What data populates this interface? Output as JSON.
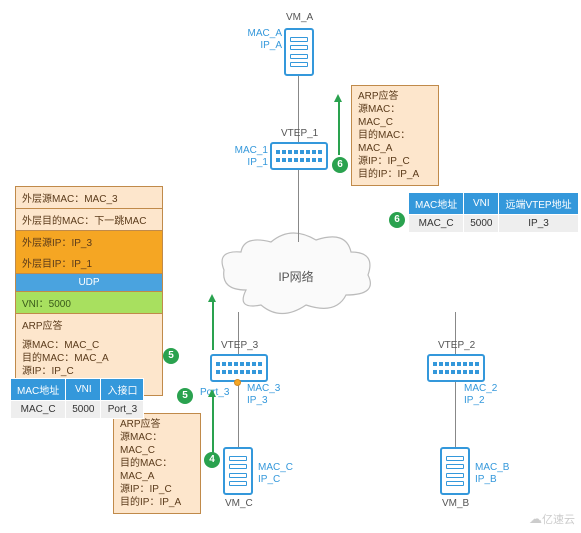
{
  "vm_a": {
    "mac": "MAC_A",
    "ip": "IP_A",
    "label": "VM_A"
  },
  "vm_b": {
    "mac": "MAC_B",
    "ip": "IP_B",
    "label": "VM_B"
  },
  "vm_c": {
    "mac": "MAC_C",
    "ip": "IP_C",
    "label": "VM_C"
  },
  "vtep1": {
    "name": "VTEP_1",
    "mac": "MAC_1",
    "ip": "IP_1"
  },
  "vtep2": {
    "name": "VTEP_2",
    "mac": "MAC_2",
    "ip": "IP_2"
  },
  "vtep3": {
    "name": "VTEP_3",
    "mac": "MAC_3",
    "ip": "IP_3",
    "port": "Port_3"
  },
  "cloud_label": "IP网络",
  "step4": "4",
  "step5a": "5",
  "step5b": "5",
  "step6a": "6",
  "step6b": "6",
  "packet_outer": {
    "l2_src": "外层源MAC：MAC_3",
    "l2_dst": "外层目的MAC：下一跳MAC",
    "l3_src": "外层源IP：IP_3",
    "l3_dst": "外层目IP：IP_1",
    "udp": "UDP",
    "vni": "VNI：5000"
  },
  "arp_reply": {
    "title": "ARP应答",
    "src_mac": "源MAC：MAC_C",
    "dst_mac": "目的MAC：MAC_A",
    "src_ip": "源IP：IP_C",
    "dst_ip": "目的IP：IP_A"
  },
  "table_left": {
    "h1": "MAC地址",
    "h2": "VNI",
    "h3": "入接口",
    "c1": "MAC_C",
    "c2": "5000",
    "c3": "Port_3"
  },
  "table_right": {
    "h1": "MAC地址",
    "h2": "VNI",
    "h3": "远端VTEP地址",
    "c1": "MAC_C",
    "c2": "5000",
    "c3": "IP_3"
  },
  "watermark": "亿速云"
}
